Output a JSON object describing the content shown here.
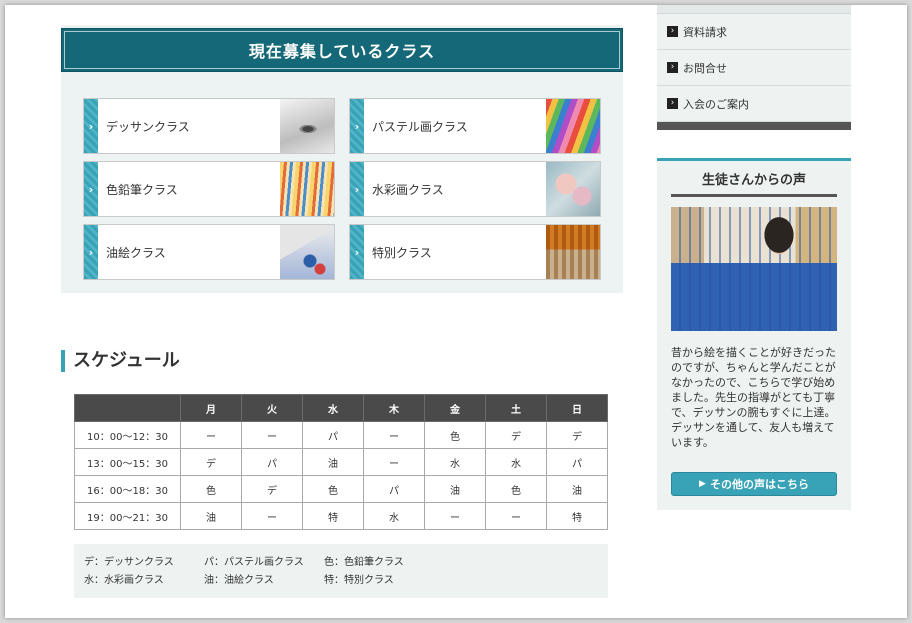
{
  "classes": {
    "title": "現在募集しているクラス",
    "items": [
      {
        "label": "デッサンクラス",
        "icon": "eye-sketch-image"
      },
      {
        "label": "パステル画クラス",
        "icon": "pastels-image"
      },
      {
        "label": "色鉛筆クラス",
        "icon": "colored-pencils-image"
      },
      {
        "label": "水彩画クラス",
        "icon": "watercolor-image"
      },
      {
        "label": "油絵クラス",
        "icon": "oil-paint-image"
      },
      {
        "label": "特別クラス",
        "icon": "special-class-image"
      }
    ],
    "chevron": "›"
  },
  "schedule": {
    "heading": "スケジュール",
    "days": [
      "月",
      "火",
      "水",
      "木",
      "金",
      "土",
      "日"
    ],
    "rows": [
      {
        "time": "10：00〜12：30",
        "cells": [
          "ー",
          "ー",
          "パ",
          "ー",
          "色",
          "デ",
          "デ"
        ]
      },
      {
        "time": "13：00〜15：30",
        "cells": [
          "デ",
          "パ",
          "油",
          "ー",
          "水",
          "水",
          "パ"
        ]
      },
      {
        "time": "16：00〜18：30",
        "cells": [
          "色",
          "デ",
          "色",
          "パ",
          "油",
          "色",
          "油"
        ]
      },
      {
        "time": "19：00〜21：30",
        "cells": [
          "油",
          "ー",
          "特",
          "水",
          "ー",
          "ー",
          "特"
        ]
      }
    ],
    "legend": [
      [
        "デ：デッサンクラス",
        "パ：パステル画クラス",
        "色：色鉛筆クラス"
      ],
      [
        "水：水彩画クラス",
        "油：油絵クラス",
        "特：特別クラス"
      ]
    ]
  },
  "sidebar": {
    "menu": [
      {
        "label": "資料請求"
      },
      {
        "label": "お問合せ"
      },
      {
        "label": "入会のご案内"
      }
    ],
    "menu_arrow": "›",
    "voice": {
      "title": "生徒さんからの声",
      "text": "昔から絵を描くことが好きだったのですが、ちゃんと学んだことがなかったので、こちらで学び始めました。先生の指導がとても丁寧で、デッサンの腕もすぐに上達。デッサンを通して、友人も増えています。",
      "button_icon": "▶",
      "button_label": "その他の声はこちら"
    }
  },
  "colors": {
    "accent": "#38a2b6",
    "title_bar": "#156878",
    "table_header": "#4a4a4a",
    "panel_bg": "#eef3f2"
  }
}
